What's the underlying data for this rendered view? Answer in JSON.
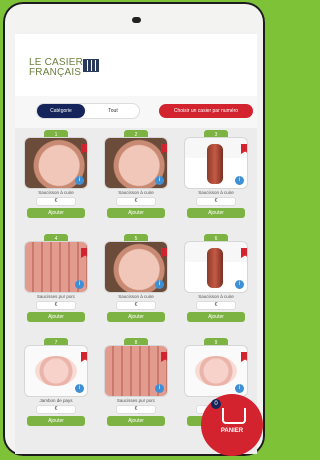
{
  "logo": {
    "line1": "LE CASIER",
    "line2": "FRANÇAIS"
  },
  "filters": {
    "active": "Catégorie",
    "inactive": "Tout",
    "choose": "Choisir un casier par numéro"
  },
  "products": [
    {
      "num": "1",
      "name": "Saucisson à cuire",
      "price": "€",
      "cta": "Ajouter",
      "img": "ham",
      "flag": true
    },
    {
      "num": "2",
      "name": "Saucisson à cuire",
      "price": "€",
      "cta": "Ajouter",
      "img": "ham",
      "flag": true
    },
    {
      "num": "3",
      "name": "Saucisson à cuire",
      "price": "€",
      "cta": "Ajouter",
      "img": "shank",
      "flag": true
    },
    {
      "num": "4",
      "name": "Saucisses pur porc",
      "price": "€",
      "cta": "Ajouter",
      "img": "sausages",
      "flag": true
    },
    {
      "num": "5",
      "name": "Saucisson à cuire",
      "price": "€",
      "cta": "Ajouter",
      "img": "ham",
      "flag": true
    },
    {
      "num": "6",
      "name": "Saucisson à cuire",
      "price": "€",
      "cta": "Ajouter",
      "img": "shank",
      "flag": true
    },
    {
      "num": "7",
      "name": "Jambon de pays",
      "price": "€",
      "cta": "Ajouter",
      "img": "slices",
      "flag": true
    },
    {
      "num": "8",
      "name": "Saucisses pur porc",
      "price": "€",
      "cta": "Ajouter",
      "img": "sausages",
      "flag": true
    },
    {
      "num": "9",
      "name": "",
      "price": "€",
      "cta": "Ajouter",
      "img": "slices",
      "flag": true
    }
  ],
  "cart": {
    "count": "0",
    "label": "PANIER"
  }
}
